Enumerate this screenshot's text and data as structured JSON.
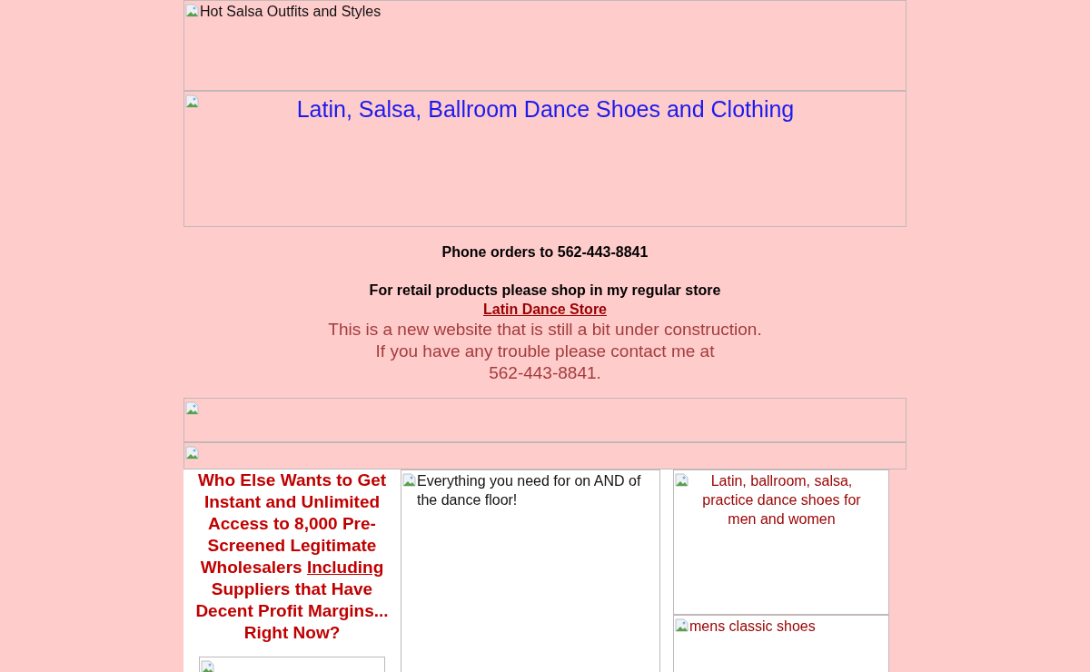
{
  "top_banners": [
    {
      "alt": "Hot Salsa Outfits and Styles"
    },
    {
      "alt": "Latin, Salsa, Ballroom Dance Shoes and Clothing"
    }
  ],
  "info": {
    "phone": "Phone orders to 562-443-8841",
    "retail_note": "For retail products please shop in my regular store",
    "store_link": "Latin Dance Store",
    "notice_lines": [
      "This is a new website that is still a bit under construction.",
      "If you have any trouble please contact me at",
      "562-443-8841."
    ]
  },
  "headline": {
    "before": "Who Else Wants to Get Instant and Unlimited Access to 8,000 Pre-Screened Legitimate Wholesalers",
    "underlined": "Including",
    "after": "Suppliers that Have Decent Profit Margins... Right Now?"
  },
  "feature_image": {
    "alt": "Everything you need for on AND of the dance floor!"
  },
  "products": [
    {
      "alt": "Latin, ballroom, salsa, practice dance shoes for men and women"
    },
    {
      "alt": "mens classic shoes"
    }
  ]
}
